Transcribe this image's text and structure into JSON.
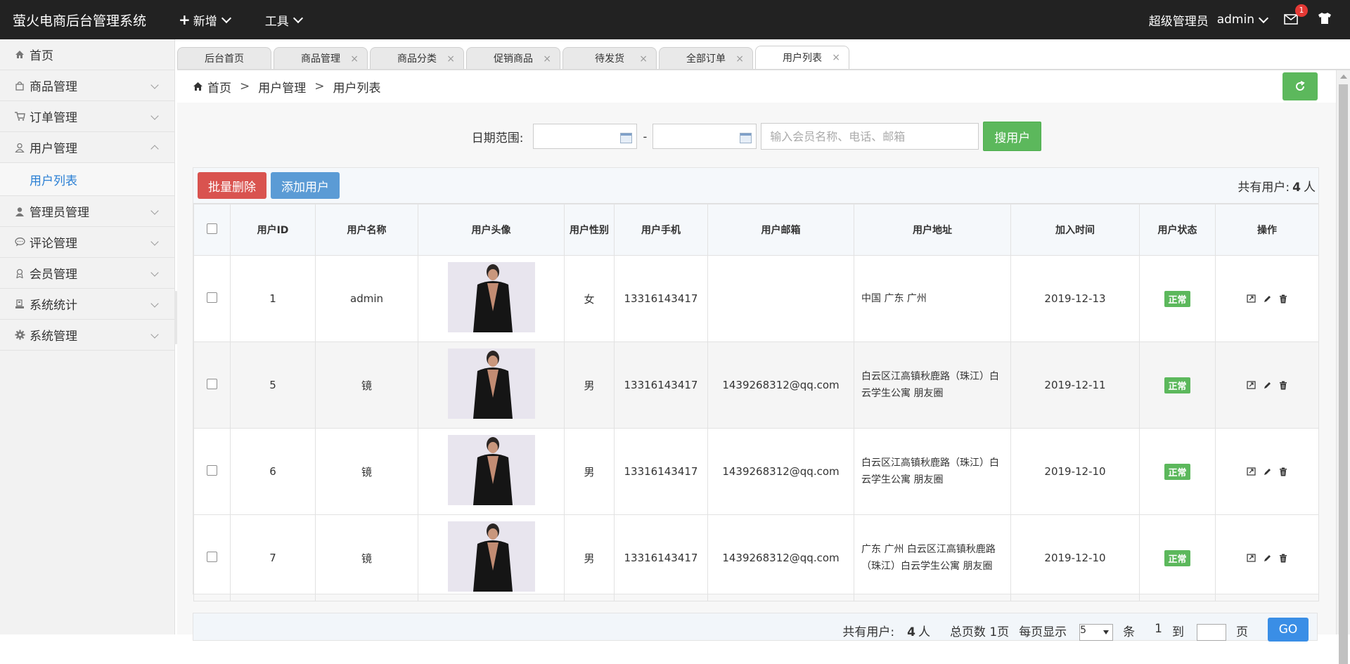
{
  "header": {
    "brand": "萤火电商后台管理系统",
    "menu_new": "新增",
    "menu_tools": "工具",
    "role": "超级管理员",
    "username": "admin",
    "mail_badge": "1"
  },
  "sidebar": {
    "items": [
      {
        "label": "首页",
        "icon": "home-icon"
      },
      {
        "label": "商品管理",
        "icon": "bag-icon"
      },
      {
        "label": "订单管理",
        "icon": "cart-icon"
      },
      {
        "label": "用户管理",
        "icon": "user-icon"
      },
      {
        "label": "管理员管理",
        "icon": "admin-icon"
      },
      {
        "label": "评论管理",
        "icon": "comment-icon"
      },
      {
        "label": "会员管理",
        "icon": "member-icon"
      },
      {
        "label": "系统统计",
        "icon": "stats-icon"
      },
      {
        "label": "系统管理",
        "icon": "gear-icon"
      }
    ],
    "sub_user_list": "用户列表"
  },
  "tabs": [
    "后台首页",
    "商品管理",
    "商品分类",
    "促销商品",
    "待发货",
    "全部订单",
    "用户列表"
  ],
  "breadcrumb": {
    "home": "首页",
    "level1": "用户管理",
    "level2": "用户列表"
  },
  "search": {
    "date_label": "日期范围:",
    "dash": "-",
    "placeholder": "输入会员名称、电话、邮箱",
    "button": "搜用户"
  },
  "toolbar": {
    "batch_delete": "批量删除",
    "add_user": "添加用户",
    "total_prefix": "共有用户:",
    "total_count": "4",
    "total_suffix": "人"
  },
  "table": {
    "headers": [
      "用户ID",
      "用户名称",
      "用户头像",
      "用户性别",
      "用户手机",
      "用户邮箱",
      "用户地址",
      "加入时间",
      "用户状态",
      "操作"
    ],
    "rows": [
      {
        "id": "1",
        "name": "admin",
        "gender": "女",
        "phone": "13316143417",
        "email": "",
        "address": "中国 广东 广州",
        "joined": "2019-12-13",
        "status": "正常"
      },
      {
        "id": "5",
        "name": "镜",
        "gender": "男",
        "phone": "13316143417",
        "email": "1439268312@qq.com",
        "address": "白云区江高镇秋鹿路（珠江）白云学生公寓 朋友圈",
        "joined": "2019-12-11",
        "status": "正常"
      },
      {
        "id": "6",
        "name": "镜",
        "gender": "男",
        "phone": "13316143417",
        "email": "1439268312@qq.com",
        "address": "白云区江高镇秋鹿路（珠江）白云学生公寓 朋友圈",
        "joined": "2019-12-10",
        "status": "正常"
      },
      {
        "id": "7",
        "name": "镜",
        "gender": "男",
        "phone": "13316143417",
        "email": "1439268312@qq.com",
        "address": "广东 广州 白云区江高镇秋鹿路（珠江）白云学生公寓 朋友圈",
        "joined": "2019-12-10",
        "status": "正常"
      }
    ]
  },
  "pager": {
    "total_prefix": "共有用户:",
    "total_count": "4",
    "total_suffix": "人",
    "pages_label": "总页数 1页",
    "per_page_label": "每页显示",
    "per_page_value": "5",
    "per_page_unit": "条",
    "current_page": "1",
    "goto_label": "到",
    "page_unit": "页",
    "go": "GO"
  },
  "colors": {
    "green": "#5cb85c",
    "red": "#d9534f",
    "blue": "#5b9bd5",
    "topbar": "#222222"
  }
}
